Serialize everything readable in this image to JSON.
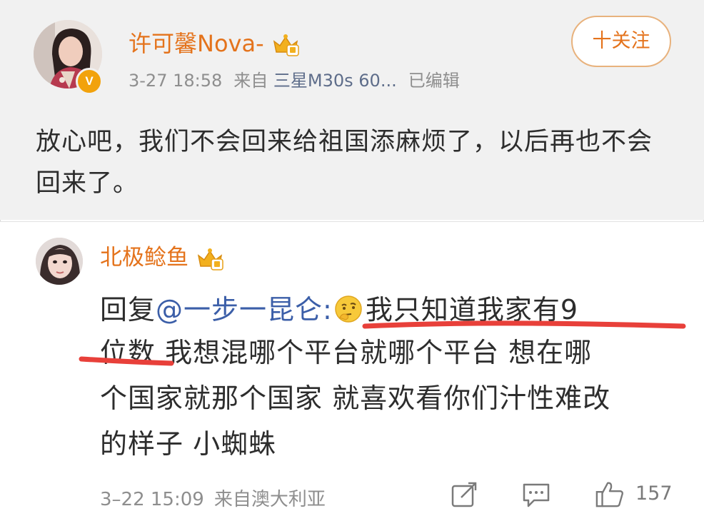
{
  "post": {
    "username": "许可馨Nova-",
    "date": "3-27 18:58",
    "source_prefix": "来自",
    "source_device": "三星M30s 60...",
    "edited": "已编辑",
    "follow_label": "十关注",
    "text": "放心吧，我们不会回来给祖国添麻烦了，以后再也不会回来了。"
  },
  "comment": {
    "username": "北极鲶鱼",
    "reply_prefix": "回复",
    "mention": "@一步一昆仑:",
    "line1_rest": "我只知道我家有9",
    "line2": "位数 我想混哪个平台就哪个平台 想在哪",
    "line3": "个国家就那个国家 就喜欢看你们汁性难改",
    "line4": "的样子 小蜘蛛",
    "date": "3–22 15:09",
    "location": "来自澳大利亚",
    "like_count": "157"
  },
  "icons": {
    "vip": "crown-badge-icon",
    "verified": "verified-v-icon",
    "emoji": "thinking-face-emoji",
    "share": "share-edit-icon",
    "comment": "comment-icon",
    "like": "thumbs-up-icon"
  },
  "colors": {
    "username": "#e4731c",
    "mention": "#3b5ea8",
    "underline": "#e8403a",
    "meta": "#8e8e8e"
  }
}
